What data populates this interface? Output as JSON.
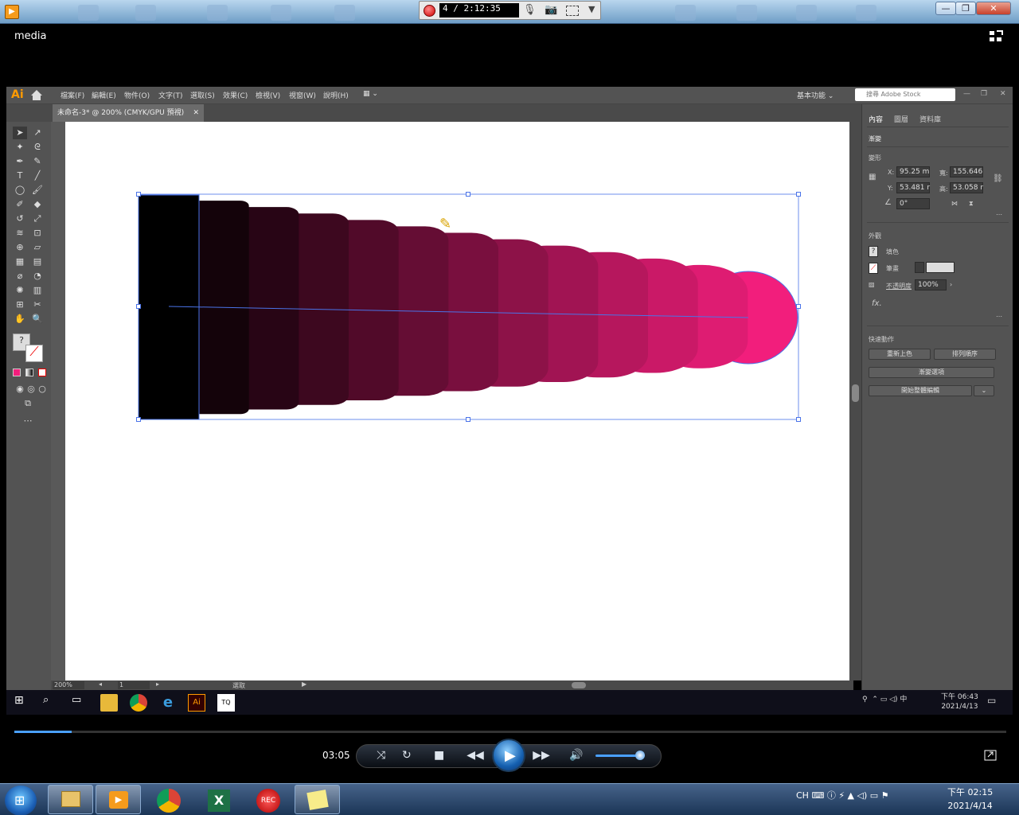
{
  "recorder": {
    "time": "4 / 2:12:35"
  },
  "media": {
    "title": "media"
  },
  "ai": {
    "logo": "Ai",
    "menus": [
      "檔案(F)",
      "編輯(E)",
      "物件(O)",
      "文字(T)",
      "選取(S)",
      "效果(C)",
      "檢視(V)",
      "視窗(W)",
      "說明(H)"
    ],
    "workspace": "基本功能",
    "search_placeholder": "搜尋 Adobe Stock",
    "doc_tab": "未命名-3* @ 200% (CMYK/GPU 預視)",
    "status": {
      "zoom": "200%",
      "artboard": "1",
      "tool": "選取"
    },
    "panel": {
      "tabs": [
        "內容",
        "圖層",
        "資料庫"
      ],
      "section_blend": "漸變",
      "transform_label": "變形",
      "x_label": "X:",
      "x": "95.25 m",
      "w_label": "寬:",
      "w": "155.646",
      "y_label": "Y:",
      "y": "53.481 r",
      "h_label": "高:",
      "h": "53.058 r",
      "angle": "0°",
      "appearance_label": "外觀",
      "fill_label": "填色",
      "stroke_label": "筆畫",
      "opacity_label": "不透明度",
      "opacity": "100%",
      "fx": "fx.",
      "quick_actions_label": "快速動作",
      "btn_recolor": "重新上色",
      "btn_arrange": "排列順序",
      "btn_blend_options": "漸變選項",
      "btn_global_edit": "開始整體編輯"
    }
  },
  "win10": {
    "tray_clock_time": "下午 06:43",
    "tray_clock_date": "2021/4/13",
    "tray_lang": "中"
  },
  "player": {
    "time": "03:05",
    "seek_fraction": 0.058,
    "volume_fraction": 0.9
  },
  "win7": {
    "lang": "CH",
    "clock_time": "下午 02:15",
    "clock_date": "2021/4/14",
    "rec_label": "REC"
  },
  "colors": {
    "blend_start": "#000000",
    "blend_end": "#f21e7c",
    "selection": "#4a73e8",
    "accent": "#4aa0ff"
  }
}
